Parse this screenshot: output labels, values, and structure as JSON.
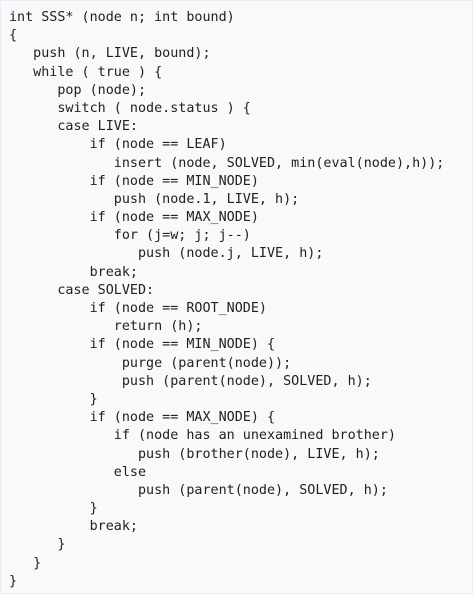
{
  "code": {
    "lines": [
      "int SSS* (node n; int bound)",
      "{",
      "   push (n, LIVE, bound);",
      "   while ( true ) {",
      "      pop (node);",
      "      switch ( node.status ) {",
      "      case LIVE:",
      "          if (node == LEAF)",
      "             insert (node, SOLVED, min(eval(node),h));",
      "          if (node == MIN_NODE)",
      "             push (node.1, LIVE, h);",
      "          if (node == MAX_NODE)",
      "             for (j=w; j; j--)",
      "                push (node.j, LIVE, h);",
      "          break;",
      "      case SOLVED:",
      "          if (node == ROOT_NODE)",
      "             return (h);",
      "          if (node == MIN_NODE) {",
      "              purge (parent(node));",
      "              push (parent(node), SOLVED, h);",
      "          }",
      "          if (node == MAX_NODE) {",
      "             if (node has an unexamined brother)",
      "                push (brother(node), LIVE, h);",
      "             else",
      "                push (parent(node), SOLVED, h);",
      "          }",
      "          break;",
      "      }",
      "   }",
      "}"
    ]
  }
}
